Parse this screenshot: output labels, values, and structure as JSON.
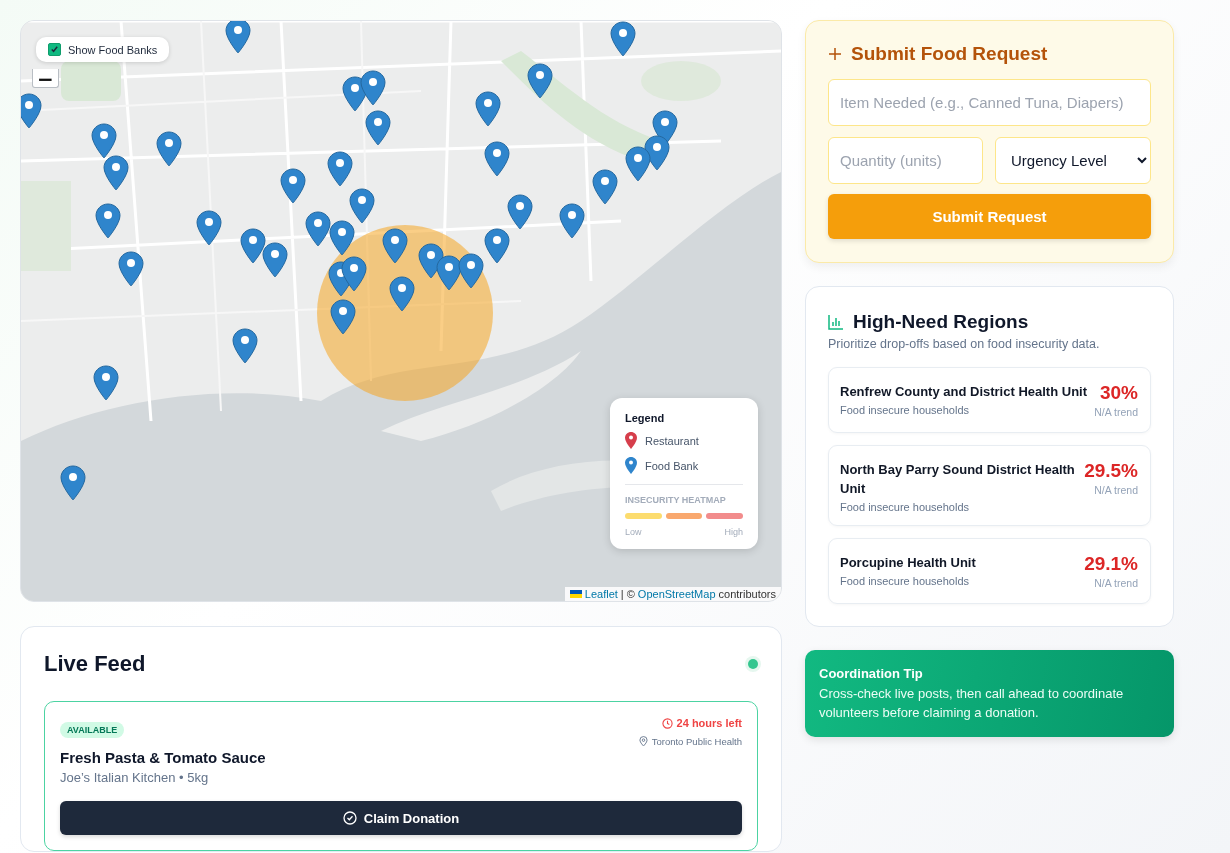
{
  "map": {
    "show_food_banks": {
      "label": "Show Food Banks",
      "checked": true
    },
    "zoom_out": "−",
    "legend": {
      "title": "Legend",
      "items": [
        {
          "label": "Restaurant",
          "color": "#d63e4b"
        },
        {
          "label": "Food Bank",
          "color": "#2f85cc"
        }
      ],
      "heatmap_title": "INSECURITY HEATMAP",
      "heatmap_scale": [
        {
          "color": "#fcdc6e"
        },
        {
          "color": "#f9a86e"
        },
        {
          "color": "#f28c8c"
        }
      ],
      "low": "Low",
      "high": "High"
    },
    "attribution": [
      {
        "kind": "link",
        "text": "Leaflet"
      },
      {
        "kind": "text",
        "text": "| ©"
      },
      {
        "kind": "link",
        "text": "OpenStreetMap"
      },
      {
        "kind": "text",
        "text": "contributors"
      }
    ]
  },
  "live_feed": {
    "title": "Live Feed",
    "live": true,
    "donations": [
      {
        "status": "AVAILABLE",
        "title": "Fresh Pasta & Tomato Sauce",
        "details": "Joe’s Italian Kitchen • 5kg",
        "time_left": "24 hours left",
        "location": "Toronto Public Health",
        "action": "Claim Donation"
      }
    ]
  },
  "request_form": {
    "title": "Submit Food Request",
    "item": {
      "placeholder": "Item Needed (e.g., Canned Tuna, Diapers)"
    },
    "quantity": {
      "placeholder": "Quantity (units)"
    },
    "urgency": {
      "value": "Urgency Level"
    },
    "submit": "Submit Request"
  },
  "regions": {
    "title": "High-Need Regions",
    "subtitle": "Prioritize drop-offs based on food insecurity data.",
    "items": [
      {
        "name": "Renfrew County and District Health Unit",
        "metric": "Food insecure households",
        "value": "30%",
        "trend": "N/A trend"
      },
      {
        "name": "North Bay Parry Sound District Health Unit",
        "metric": "Food insecure households",
        "value": "29.5%",
        "trend": "N/A trend"
      },
      {
        "name": "Porcupine Health Unit",
        "metric": "Food insecure households",
        "value": "29.1%",
        "trend": "N/A trend"
      }
    ]
  },
  "tip": {
    "title": "Coordination Tip",
    "text": "Cross-check live posts, then call ahead to coordinate volunteers before claiming a donation."
  }
}
